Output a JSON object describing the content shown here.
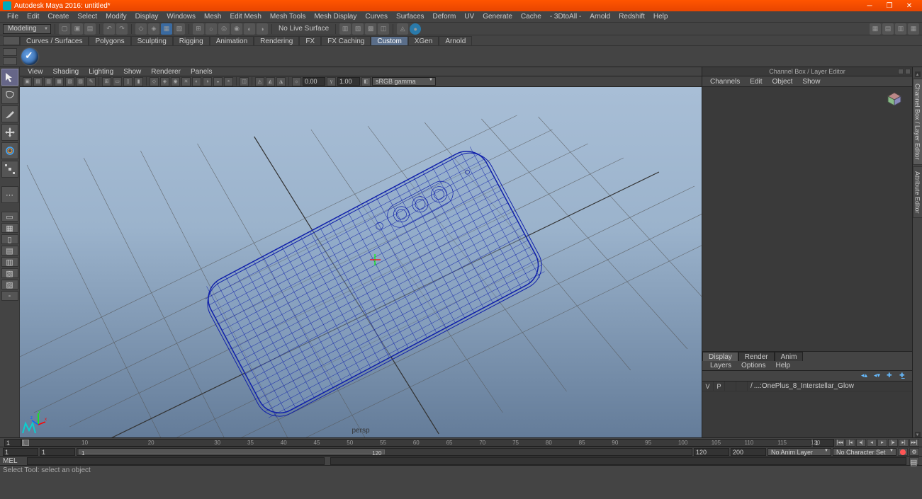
{
  "title": "Autodesk Maya 2016: untitled*",
  "menubar": [
    "File",
    "Edit",
    "Create",
    "Select",
    "Modify",
    "Display",
    "Windows",
    "Mesh",
    "Edit Mesh",
    "Mesh Tools",
    "Mesh Display",
    "Curves",
    "Surfaces",
    "Deform",
    "UV",
    "Generate",
    "Cache",
    "- 3DtoAll -",
    "Arnold",
    "Redshift",
    "Help"
  ],
  "workspace_dd": "Modeling",
  "statusline_text": "No Live Surface",
  "shelf_tabs": [
    "Curves / Surfaces",
    "Polygons",
    "Sculpting",
    "Rigging",
    "Animation",
    "Rendering",
    "FX",
    "FX Caching",
    "Custom",
    "XGen",
    "Arnold"
  ],
  "shelf_active": 8,
  "panel_menu": [
    "View",
    "Shading",
    "Lighting",
    "Show",
    "Renderer",
    "Panels"
  ],
  "panel_num1": "0.00",
  "panel_num2": "1.00",
  "panel_colorspace": "sRGB gamma",
  "camera_name": "persp",
  "channelbox_title": "Channel Box / Layer Editor",
  "channelbox_menu": [
    "Channels",
    "Edit",
    "Object",
    "Show"
  ],
  "display_tabs": [
    "Display",
    "Render",
    "Anim"
  ],
  "layer_menu": [
    "Layers",
    "Options",
    "Help"
  ],
  "layer_row": {
    "v": "V",
    "p": "P",
    "slash": "/",
    "name": "...:OnePlus_8_Interstellar_Glow"
  },
  "side_tabs": [
    "Channel Box / Layer Editor",
    "Attribute Editor"
  ],
  "timeline": {
    "start": 1,
    "end": 120,
    "ticks": [
      1,
      10,
      20,
      30,
      35,
      40,
      45,
      50,
      55,
      60,
      65,
      70,
      75,
      80,
      85,
      90,
      95,
      100,
      105,
      110,
      115,
      120
    ],
    "curframe": 1
  },
  "range": {
    "outer_start": 1,
    "inner_start": 1,
    "inner_end": 120,
    "outer_end": 120,
    "fps": 200
  },
  "anim_layer_dd": "No Anim Layer",
  "char_set_dd": "No Character Set",
  "cmd_label": "MEL",
  "helpline": "Select Tool: select an object"
}
